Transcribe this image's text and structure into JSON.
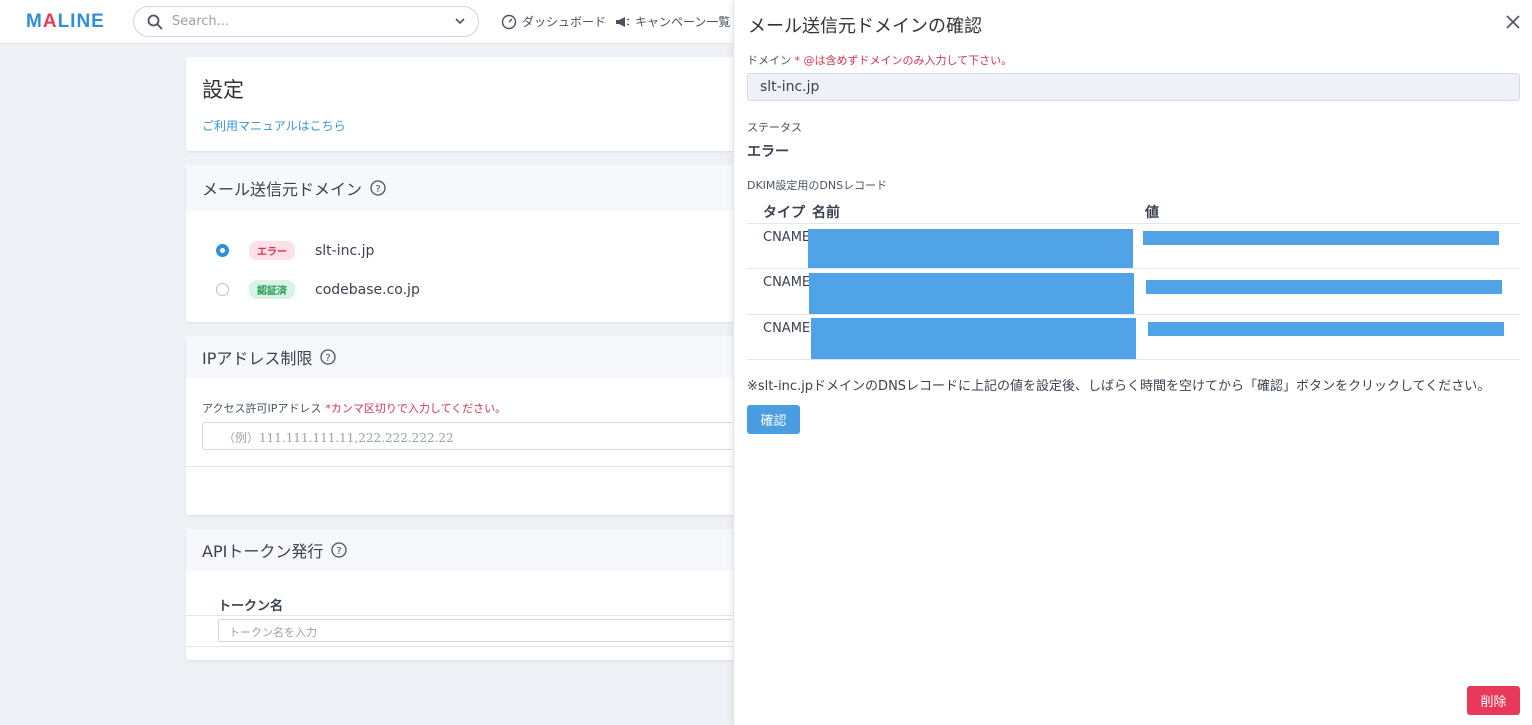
{
  "topbar": {
    "logo_a": "M",
    "logo_b": "A",
    "logo_c": "LINE",
    "search_placeholder": "Search...",
    "nav": [
      "ダッシュボード",
      "キャンペーン一覧"
    ]
  },
  "settings": {
    "title": "設定",
    "manual_link": "ご利用マニュアルはこちら"
  },
  "sender_domain": {
    "heading": "メール送信元ドメイン",
    "domains": [
      {
        "status": "エラー",
        "name": "slt-inc.jp",
        "selected": true
      },
      {
        "status": "認証済",
        "name": "codebase.co.jp",
        "selected": false
      }
    ]
  },
  "ip_restriction": {
    "heading": "IPアドレス制限",
    "label": "アクセス許可IPアドレス",
    "hint": "*カンマ区切りで入力してください。",
    "placeholder": "（例）111.111.111.11,222.222.222.22"
  },
  "api_token": {
    "heading": "APIトークン発行",
    "column": "トークン名",
    "placeholder": "トークン名を入力"
  },
  "drawer": {
    "title": "メール送信元ドメインの確認",
    "domain_label": "ドメイン",
    "domain_req": "* @は含めずドメインのみ入力して下さい。",
    "domain_value": "slt-inc.jp",
    "status_label": "ステータス",
    "status_value": "エラー",
    "dkim_label": "DKIM設定用のDNSレコード",
    "columns": [
      "タイプ",
      "名前",
      "値"
    ],
    "records": [
      {
        "type": "CNAME"
      },
      {
        "type": "CNAME"
      },
      {
        "type": "CNAME"
      }
    ],
    "note": "※slt-inc.jpドメインのDNSレコードに上記の値を設定後、しばらく時間を空けてから「確認」ボタンをクリックしてください。",
    "confirm_label": "確認",
    "delete_label": "削除"
  },
  "colors": {
    "accent": "#2f8fd8",
    "danger": "#e8395a",
    "redaction": "#4fa3e6"
  }
}
